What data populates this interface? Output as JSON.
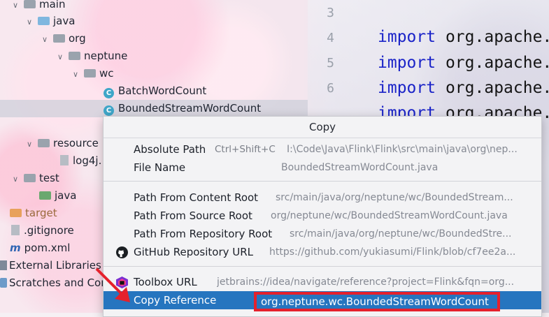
{
  "project_tree": {
    "items": [
      {
        "label": "main",
        "expanded": true,
        "icon": "folder-icon"
      },
      {
        "label": "java",
        "expanded": true,
        "icon": "folder-icon"
      },
      {
        "label": "org",
        "expanded": true,
        "icon": "folder-icon"
      },
      {
        "label": "neptune",
        "expanded": true,
        "icon": "folder-icon"
      },
      {
        "label": "wc",
        "expanded": true,
        "icon": "folder-icon"
      },
      {
        "label": "BatchWordCount",
        "icon": "class-icon"
      },
      {
        "label": "BoundedStreamWordCount",
        "icon": "class-icon",
        "selected": true
      },
      {
        "label": "resource",
        "expanded": true,
        "icon": "folder-icon"
      },
      {
        "label": "log4j.",
        "icon": "file-icon"
      },
      {
        "label": "test",
        "expanded": true,
        "icon": "folder-icon"
      },
      {
        "label": "java",
        "icon": "folder-icon"
      },
      {
        "label": "target",
        "icon": "folder-icon"
      },
      {
        "label": ".gitignore",
        "icon": "file-icon"
      },
      {
        "label": "pom.xml",
        "icon": "maven-icon"
      },
      {
        "label": "External Libraries",
        "icon": "library-icon"
      },
      {
        "label": "Scratches and Con",
        "icon": "scratch-icon"
      }
    ]
  },
  "editor": {
    "line_numbers": [
      "3",
      "4",
      "5",
      "6"
    ],
    "code_lines": [
      {
        "keyword": "import",
        "text": "org.apache."
      },
      {
        "keyword": "import",
        "text": "org.apache."
      },
      {
        "keyword": "import",
        "text": "org.apache."
      },
      {
        "keyword": "import",
        "text": "org.apache."
      }
    ]
  },
  "copy_popup": {
    "title": "Copy",
    "items": [
      {
        "label": "Absolute Path",
        "shortcut": "Ctrl+Shift+C",
        "value": "I:\\Code\\Java\\Flink\\Flink\\src\\main\\java\\org\\nep..."
      },
      {
        "label": "File Name",
        "value": "BoundedStreamWordCount.java"
      },
      {
        "label": "Path From Content Root",
        "value": "src/main/java/org/neptune/wc/BoundedStream..."
      },
      {
        "label": "Path From Source Root",
        "value": "org/neptune/wc/BoundedStreamWordCount.java"
      },
      {
        "label": "Path From Repository Root",
        "value": "src/main/java/org/neptune/wc/BoundedStre..."
      },
      {
        "label": "GitHub Repository URL",
        "value": "https://github.com/yukiasumi/Flink/blob/cf7ee2a...",
        "icon": "github-icon"
      },
      {
        "label": "Toolbox URL",
        "value": "jetbrains://idea/navigate/reference?project=Flink&fqn=org...",
        "icon": "toolbox-icon"
      },
      {
        "label": "Copy Reference",
        "value": "org.neptune.wc.BoundedStreamWordCount",
        "active": true
      }
    ]
  },
  "colors": {
    "accent": "#2675bf",
    "annotation": "#e5212c"
  }
}
